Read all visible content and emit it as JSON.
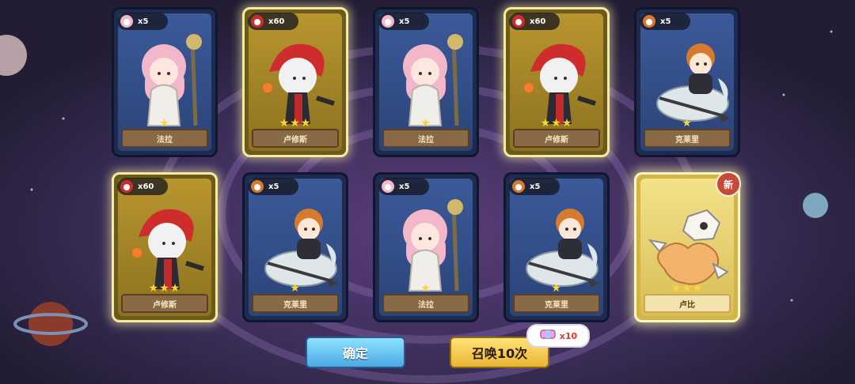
{
  "cards": [
    {
      "name": "法拉",
      "count": "x5",
      "stars": "★",
      "variant": "blue",
      "character": "mage-girl"
    },
    {
      "name": "卢修斯",
      "count": "x60",
      "stars": "★★★",
      "variant": "gold",
      "character": "red-hair-hero"
    },
    {
      "name": "法拉",
      "count": "x5",
      "stars": "★",
      "variant": "blue",
      "character": "mage-girl"
    },
    {
      "name": "卢修斯",
      "count": "x60",
      "stars": "★★★",
      "variant": "gold",
      "character": "red-hair-hero"
    },
    {
      "name": "克莱里",
      "count": "x5",
      "stars": "★",
      "variant": "blue",
      "character": "lancer-rider"
    },
    {
      "name": "卢修斯",
      "count": "x60",
      "stars": "★★★",
      "variant": "gold",
      "character": "red-hair-hero"
    },
    {
      "name": "克莱里",
      "count": "x5",
      "stars": "★",
      "variant": "blue",
      "character": "lancer-rider"
    },
    {
      "name": "法拉",
      "count": "x5",
      "stars": "★",
      "variant": "blue",
      "character": "mage-girl"
    },
    {
      "name": "克莱里",
      "count": "x5",
      "stars": "★",
      "variant": "blue",
      "character": "lancer-rider"
    },
    {
      "name": "卢比",
      "count": "",
      "stars": "★★★",
      "variant": "golden",
      "character": "bone-dragon",
      "badge": "新"
    }
  ],
  "buttons": {
    "confirm_label": "确定",
    "summon10_label": "召唤10次"
  },
  "cost": {
    "amount": "x10",
    "icon": "ticket-icon"
  },
  "colors": {
    "star": "#ffd534",
    "gold_border": "#f4eba0",
    "blue_card": "#2b4478"
  }
}
